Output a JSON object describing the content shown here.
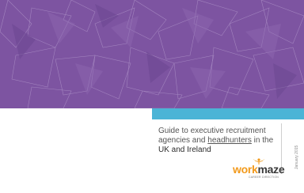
{
  "cover": {
    "title_line1": "Guide to executive recruitment",
    "title_line2_pre": "agencies and ",
    "title_line2_link": "headhunters",
    "title_line2_post": " in the",
    "title_line3": "UK and Ireland",
    "side_date": "January 2015"
  },
  "logo": {
    "word_a": "work",
    "word_b": "maze",
    "tagline": "CAREER DIRECTION"
  },
  "colors": {
    "banner": "#7d54a1",
    "strip": "#4bb4d6",
    "logo_orange": "#f29a1c"
  }
}
